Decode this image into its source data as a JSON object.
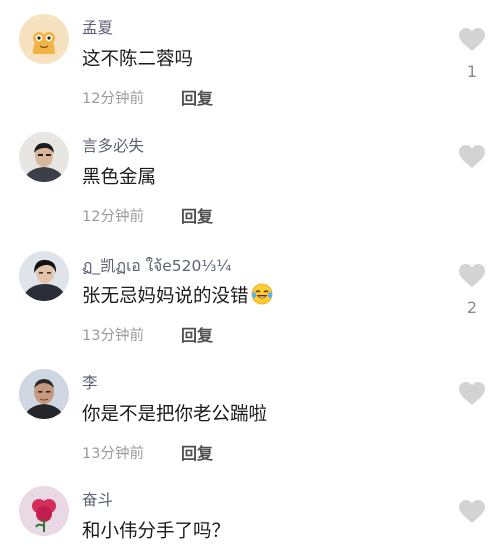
{
  "comments": [
    {
      "username": "孟夏",
      "text": "这不陈二蓉吗",
      "time": "12分钟前",
      "reply_label": "回复",
      "like_count": "1"
    },
    {
      "username": "言多必失",
      "text": "黑色金属",
      "time": "12分钟前",
      "reply_label": "回复",
      "like_count": ""
    },
    {
      "username": "ฏ_凯ฏเอ ใจ้e520⅓¼",
      "text": "张无忌妈妈说的没错",
      "emoji": "laughing-with-tears",
      "time": "13分钟前",
      "reply_label": "回复",
      "like_count": "2"
    },
    {
      "username": "李",
      "text": "你是不是把你老公踹啦",
      "time": "13分钟前",
      "reply_label": "回复",
      "like_count": ""
    },
    {
      "username": "奋斗",
      "text": "和小伟分手了吗？",
      "time": "",
      "reply_label": "",
      "like_count": ""
    }
  ],
  "colors": {
    "username": "#5c6273",
    "text": "#1b1b1b",
    "meta": "#9b9b9b",
    "heart": "#d3d3d3"
  },
  "icons": {
    "like": "heart-icon",
    "emoji": "laughing-crying-emoji"
  }
}
